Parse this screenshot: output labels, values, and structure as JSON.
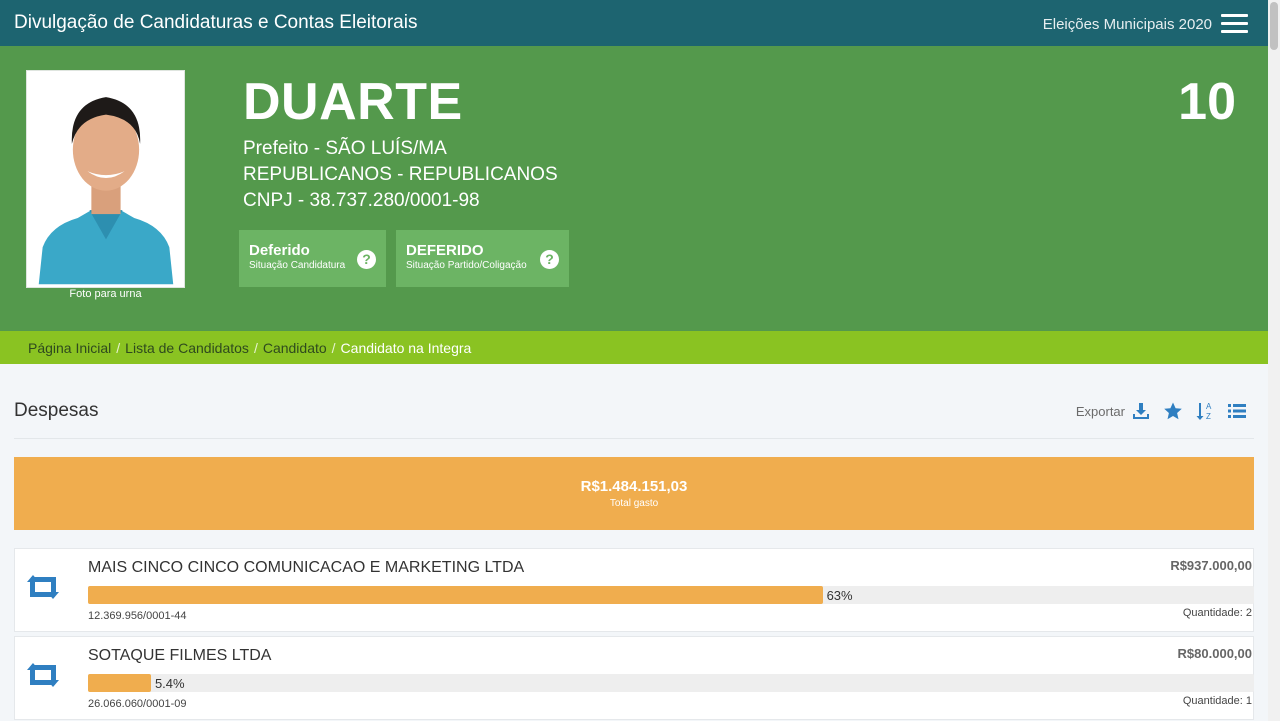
{
  "header": {
    "title": "Divulgação de Candidaturas e Contas Eleitorais",
    "election": "Eleições Municipais 2020",
    "menu_icon": "hamburger-menu-icon"
  },
  "candidate": {
    "name": "DUARTE",
    "number": "10",
    "office": "Prefeito - SÃO LUÍS/MA",
    "party": "REPUBLICANOS - REPUBLICANOS",
    "cnpj": "CNPJ - 38.737.280/0001-98",
    "photo_caption": "Foto para urna",
    "status": {
      "main": "Deferido",
      "label": "Situação Candidatura"
    },
    "party_status": {
      "main": "DEFERIDO",
      "label": "Situação Partido/Coligação"
    }
  },
  "breadcrumb": [
    "Página Inicial",
    "Lista de Candidatos",
    "Candidato",
    "Candidato na Integra"
  ],
  "section": {
    "title": "Despesas",
    "export_label": "Exportar"
  },
  "total": {
    "value": "R$1.484.151,03",
    "label": "Total gasto"
  },
  "expenses": [
    {
      "name": "MAIS CINCO CINCO COMUNICACAO E MARKETING LTDA",
      "value": "R$937.000,00",
      "percent_label": "63%",
      "percent": 63,
      "doc": "12.369.956/0001-44",
      "quantity": "Quantidade: 2"
    },
    {
      "name": "SOTAQUE FILMES LTDA",
      "value": "R$80.000,00",
      "percent_label": "5.4%",
      "percent": 5.4,
      "doc": "26.066.060/0001-09",
      "quantity": "Quantidade: 1"
    }
  ],
  "colors": {
    "topbar": "#1d6470",
    "hero": "#54994c",
    "breadcrumb": "#8ac322",
    "accent_orange": "#f0ad4e",
    "icon_blue": "#2f7fc1"
  }
}
